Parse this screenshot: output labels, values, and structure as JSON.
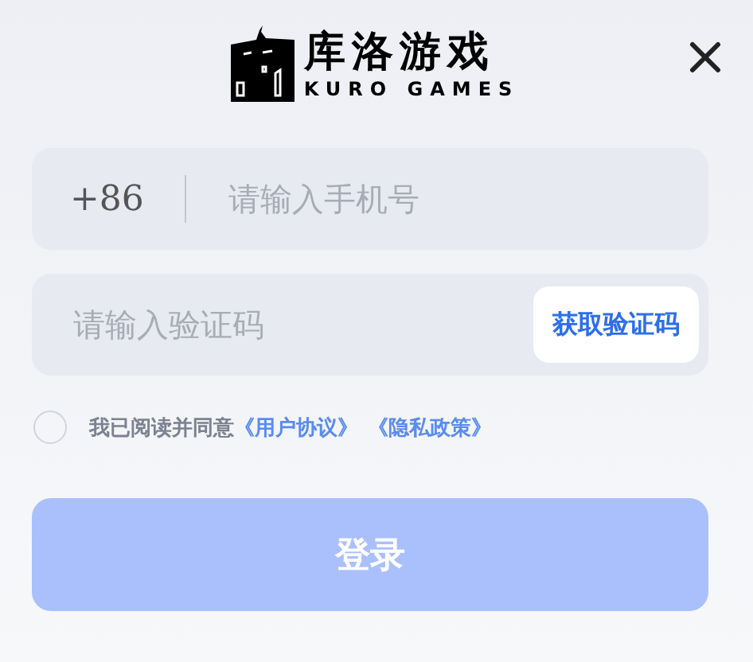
{
  "logo": {
    "name": "库洛游戏",
    "subtitle": "KURO GAMES"
  },
  "phone": {
    "country_code": "+86",
    "placeholder": "请输入手机号"
  },
  "code": {
    "placeholder": "请输入验证码",
    "button": "获取验证码"
  },
  "agreement": {
    "checked": false,
    "text": "我已阅读并同意",
    "links": [
      "《用户协议》",
      "《隐私政策》"
    ]
  },
  "login_button": {
    "label": "登录",
    "disabled": true
  }
}
